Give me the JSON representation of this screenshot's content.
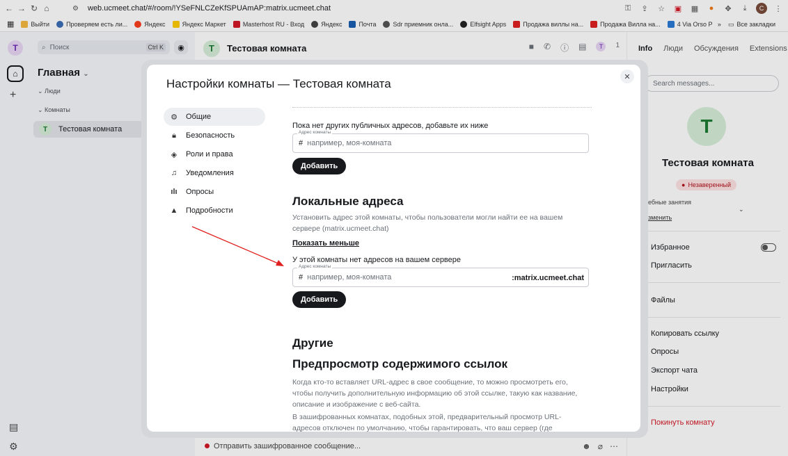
{
  "browser": {
    "url": "web.ucmeet.chat/#/room/!YSeFNLCZeKfSPUAmAP:matrix.ucmeet.chat",
    "bookmarks": [
      "Выйти",
      "Проверяем есть ли...",
      "Яндекс",
      "Яндекс Маркет",
      "Masterhost RU - Вход",
      "Яндекс",
      "Почта",
      "Sdr приемник онла...",
      "Elfsight Apps",
      "Продажа виллы на...",
      "Продажа Вилла на...",
      "4 Via Orso Partecipa..."
    ],
    "all_bookmarks": "Все закладки",
    "more": "»",
    "profile_letter": "C"
  },
  "spaces": {
    "avatar": "T"
  },
  "roomlist": {
    "search_label": "Поиск",
    "search_shortcut": "Ctrl K",
    "title": "Главная",
    "section_people": "Люди",
    "section_rooms": "Комнаты",
    "room_avatar": "T",
    "room_name": "Тестовая комната"
  },
  "header": {
    "avatar": "T",
    "room_name": "Тестовая комната",
    "member_count": "1",
    "member_avatar": "T"
  },
  "composer": {
    "placeholder": "Отправить зашифрованное сообщение..."
  },
  "rightpanel": {
    "tabs": [
      "Info",
      "Люди",
      "Обсуждения",
      "Extensions"
    ],
    "search_placeholder": "Search messages...",
    "avatar": "T",
    "room_name": "Тестовая комната",
    "badge": "Незаверенный",
    "topic": "ебные занятия",
    "edit": "зменить",
    "favourite": "Избранное",
    "invite": "Пригласить",
    "files": "Файлы",
    "copy_link": "Копировать ссылку",
    "polls": "Опросы",
    "export": "Экспорт чата",
    "settings": "Настройки",
    "leave": "Покинуть комнату",
    "favourite_enabled": false
  },
  "modal": {
    "title": "Настройки комнаты — Тестовая комната",
    "nav": [
      {
        "label": "Общие",
        "icon": "gear-icon"
      },
      {
        "label": "Безопасность",
        "icon": "lock-icon"
      },
      {
        "label": "Роли и права",
        "icon": "shield-icon"
      },
      {
        "label": "Уведомления",
        "icon": "bell-icon"
      },
      {
        "label": "Опросы",
        "icon": "poll-icon"
      },
      {
        "label": "Подробности",
        "icon": "warning-icon"
      }
    ],
    "no_public": "Пока нет других публичных адресов, добавьте их ниже",
    "field_legend": "Адрес комнаты",
    "field_placeholder": "например, моя-комната",
    "hash": "#",
    "add_button": "Добавить",
    "local_title": "Локальные адреса",
    "local_desc": "Установить адрес этой комнаты, чтобы пользователи могли найти ее на вашем сервере (matrix.ucmeet.chat)",
    "show_less": "Показать меньше",
    "no_local": "У этой комнаты нет адресов на вашем сервере",
    "server_suffix": ":matrix.ucmeet.chat",
    "other_title": "Другие",
    "preview_title": "Предпросмотр содержимого ссылок",
    "preview_desc": "Когда кто-то вставляет URL-адрес в свое сообщение, то можно просмотреть его, чтобы получить дополнительную информацию об этой ссылке, такую как название, описание и изображение с веб-сайта.",
    "preview_desc2": "В зашифрованных комнатах, подобных этой, предварительный просмотр URL-адресов отключен по умолчанию, чтобы гарантировать, что ваш сервер (где создаются"
  },
  "colors": {
    "accent": "#17191c",
    "danger": "#d51928",
    "annotation_arrow": "#e02020"
  }
}
